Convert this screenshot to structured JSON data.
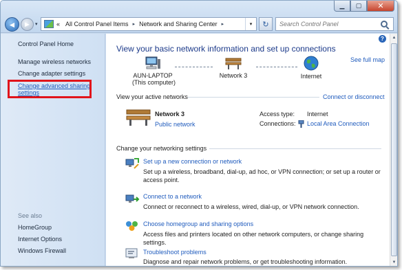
{
  "window_buttons": {
    "minimize": "▁",
    "maximize": "▢",
    "close": "✕"
  },
  "nav": {
    "back": "◄",
    "forward": "►",
    "dropdown": "▾"
  },
  "address": {
    "chevron": "«",
    "segments": [
      "All Control Panel Items",
      "Network and Sharing Center"
    ],
    "separator": "▸",
    "dropdown": "▾"
  },
  "refresh": "↻",
  "search": {
    "placeholder": "Search Control Panel"
  },
  "sidebar": {
    "items": [
      {
        "label": "Control Panel Home"
      },
      {
        "label": "Manage wireless networks"
      },
      {
        "label": "Change adapter settings"
      },
      {
        "label": "Change advanced sharing settings"
      }
    ],
    "see_also_label": "See also",
    "see_also": [
      {
        "label": "HomeGroup"
      },
      {
        "label": "Internet Options"
      },
      {
        "label": "Windows Firewall"
      }
    ]
  },
  "main": {
    "help": "?",
    "heading": "View your basic network information and set up connections",
    "see_full_map": "See full map",
    "map": {
      "computer": {
        "name": "AUN-LAPTOP",
        "sub": "(This computer)"
      },
      "network": {
        "name": "Network 3"
      },
      "internet": {
        "name": "Internet"
      }
    },
    "active_title": "View your active networks",
    "connect_disconnect": "Connect or disconnect",
    "active": {
      "name": "Network  3",
      "type": "Public network",
      "access_type_label": "Access type:",
      "access_type_value": "Internet",
      "connections_label": "Connections:",
      "connections_value": "Local Area Connection"
    },
    "change_title": "Change your networking settings",
    "tasks": [
      {
        "link": "Set up a new connection or network",
        "desc": "Set up a wireless, broadband, dial-up, ad hoc, or VPN connection; or set up a router or access point.",
        "icon": "new-connection-icon"
      },
      {
        "link": "Connect to a network",
        "desc": "Connect or reconnect to a wireless, wired, dial-up, or VPN network connection.",
        "icon": "connect-network-icon"
      },
      {
        "link": "Choose homegroup and sharing options",
        "desc": "Access files and printers located on other network computers, or change sharing settings.",
        "icon": "homegroup-icon"
      },
      {
        "link": "Troubleshoot problems",
        "desc": "Diagnose and repair network problems, or get troubleshooting information.",
        "icon": "troubleshoot-icon"
      }
    ]
  },
  "colors": {
    "link": "#1f5bbd",
    "heading": "#1c3a8a",
    "highlight": "#e1141b",
    "sidebar": "#d9e6f5"
  }
}
